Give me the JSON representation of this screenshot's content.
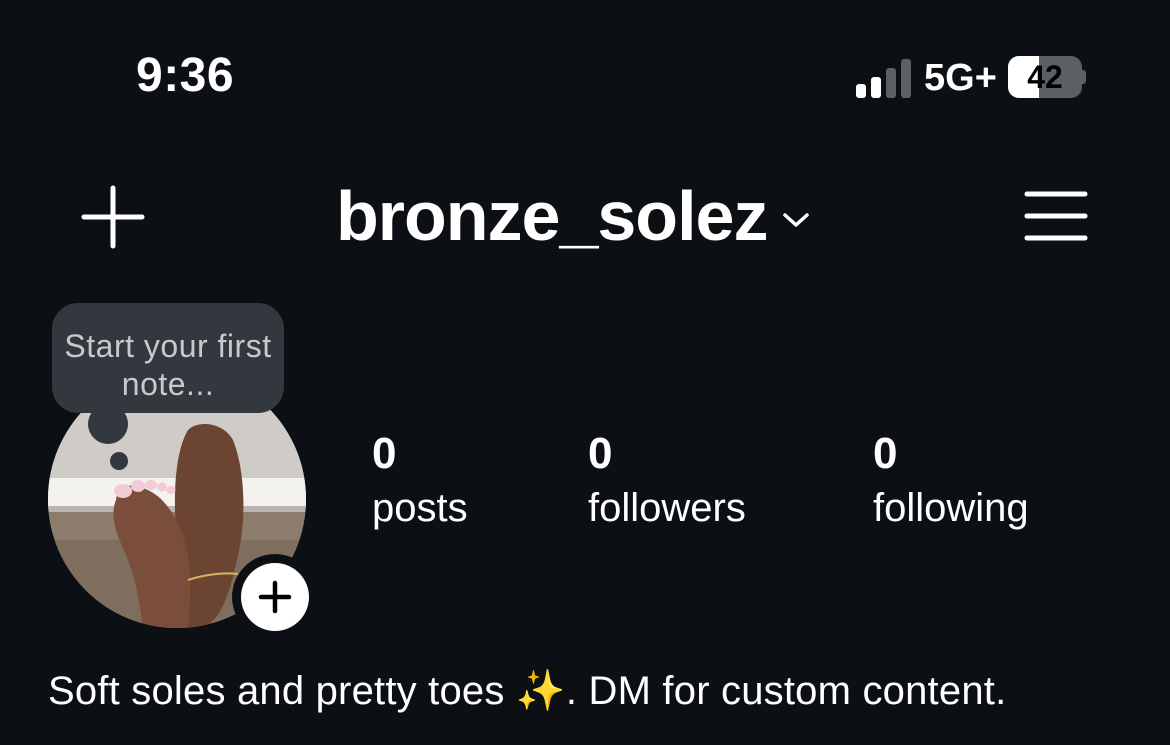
{
  "status_bar": {
    "time": "9:36",
    "network": "5G+",
    "battery_level": "42",
    "battery_fraction": 0.42,
    "signal_bars_active": 2,
    "signal_bars_total": 4
  },
  "header": {
    "username": "bronze_solez",
    "new_post_icon": "plus-icon",
    "menu_icon": "hamburger-menu-icon",
    "switch_account_icon": "chevron-down-icon"
  },
  "note": {
    "prompt": "Start your first note..."
  },
  "stats": {
    "posts": {
      "count": "0",
      "label": "posts"
    },
    "followers": {
      "count": "0",
      "label": "followers"
    },
    "following": {
      "count": "0",
      "label": "following"
    }
  },
  "bio": "Soft soles and pretty toes ✨. DM for custom content.",
  "colors": {
    "background": "#0c1014",
    "bubble": "#33383e",
    "text": "#ffffff"
  }
}
